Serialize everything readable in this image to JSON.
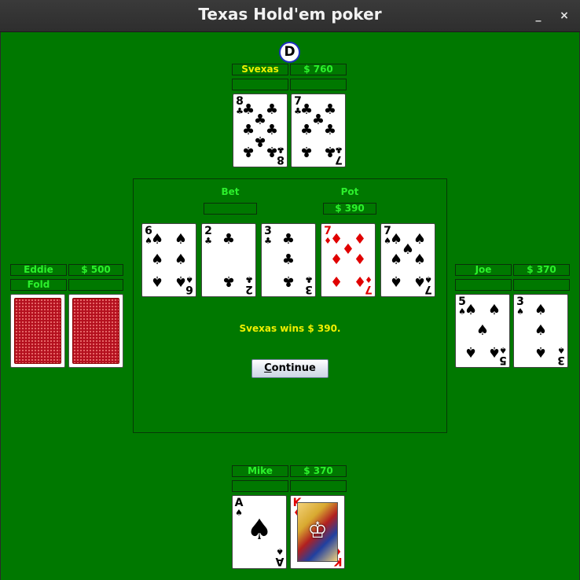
{
  "window": {
    "title": "Texas Hold'em poker",
    "minimize": "_",
    "close": "×"
  },
  "dealer_button": "D",
  "players": {
    "top": {
      "name": "Svexas",
      "chips": "$ 760",
      "action": "",
      "cards": [
        {
          "rank": "8",
          "suit": "♣",
          "color": "black"
        },
        {
          "rank": "7",
          "suit": "♣",
          "color": "black"
        }
      ]
    },
    "left": {
      "name": "Eddie",
      "chips": "$ 500",
      "action": "Fold",
      "cards": [
        {
          "back": true
        },
        {
          "back": true
        }
      ]
    },
    "right": {
      "name": "Joe",
      "chips": "$ 370",
      "action": "",
      "cards": [
        {
          "rank": "5",
          "suit": "♠",
          "color": "black"
        },
        {
          "rank": "3",
          "suit": "♠",
          "color": "black"
        }
      ]
    },
    "bottom": {
      "name": "Mike",
      "chips": "$ 370",
      "action": "",
      "cards": [
        {
          "rank": "A",
          "suit": "♠",
          "color": "black"
        },
        {
          "rank": "K",
          "suit": "♦",
          "color": "red"
        }
      ]
    }
  },
  "board": {
    "bet_label": "Bet",
    "bet_value": "",
    "pot_label": "Pot",
    "pot_value": "$ 390",
    "cards": [
      {
        "rank": "6",
        "suit": "♠",
        "color": "black"
      },
      {
        "rank": "2",
        "suit": "♣",
        "color": "black"
      },
      {
        "rank": "3",
        "suit": "♣",
        "color": "black"
      },
      {
        "rank": "7",
        "suit": "♦",
        "color": "red"
      },
      {
        "rank": "7",
        "suit": "♠",
        "color": "black"
      }
    ]
  },
  "message": "Svexas wins $ 390.",
  "continue_button": {
    "mnemonic": "C",
    "rest": "ontinue"
  }
}
